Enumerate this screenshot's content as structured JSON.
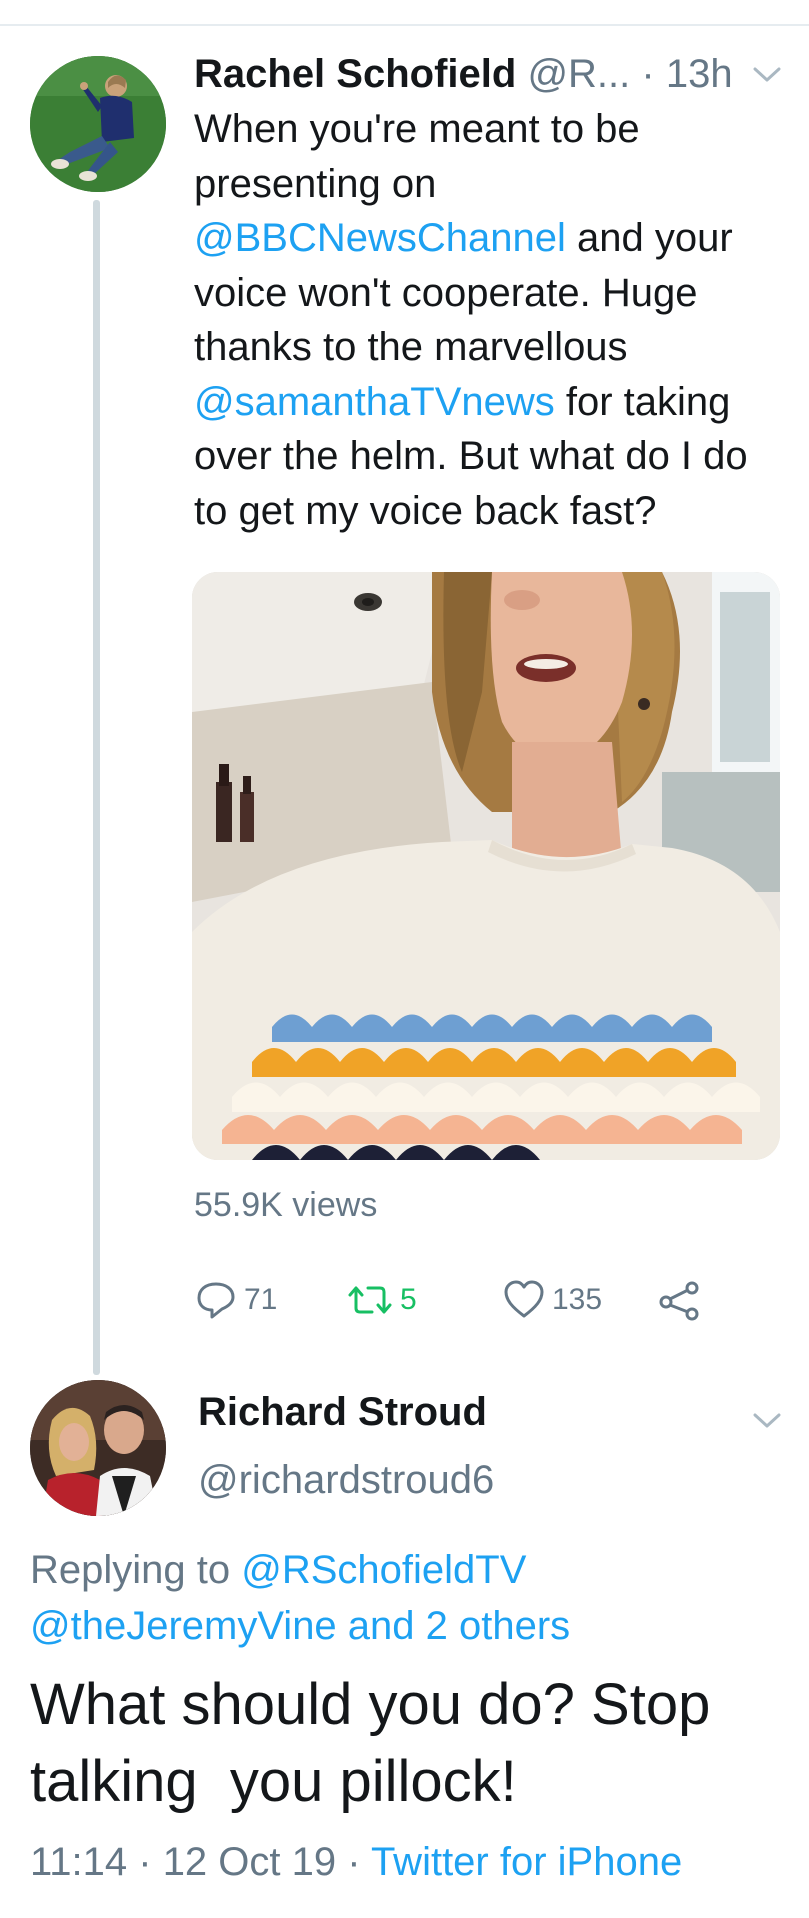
{
  "tweet": {
    "author_name": "Rachel Schofield",
    "author_handle": "@R...",
    "time_sep": " · ",
    "time": "13h",
    "text_part1": "When you're meant to be presenting on ",
    "mention1": "@BBCNewsChannel",
    "text_part2": " and your voice won't cooperate. Huge thanks to the marvellous ",
    "mention2": "@samanthaTVnews",
    "text_part3": " for taking over the helm. But what do I do to get my voice back fast?",
    "views": "55.9K views",
    "actions": {
      "reply_count": "71",
      "retweet_count": "5",
      "like_count": "135"
    }
  },
  "reply": {
    "author_name": "Richard Stroud",
    "author_handle": "@richardstroud6",
    "replying_prefix": "Replying to ",
    "replying_mention1": "@RSchofieldTV",
    "replying_mention2": "@theJeremyVine",
    "replying_rest": " and 2 others",
    "text": "What should you do? Stop talking  you pillock!",
    "time": "11:14",
    "sep1": " · ",
    "date": "12 Oct 19",
    "sep2": " · ",
    "source": "Twitter for iPhone"
  },
  "colors": {
    "link": "#1da1f2",
    "secondary_text": "#657786",
    "retweet_green": "#17bf63",
    "thread_line": "#cfd9de"
  },
  "icons": [
    "reply-icon",
    "retweet-icon",
    "like-icon",
    "share-icon",
    "chevron-down-icon"
  ]
}
